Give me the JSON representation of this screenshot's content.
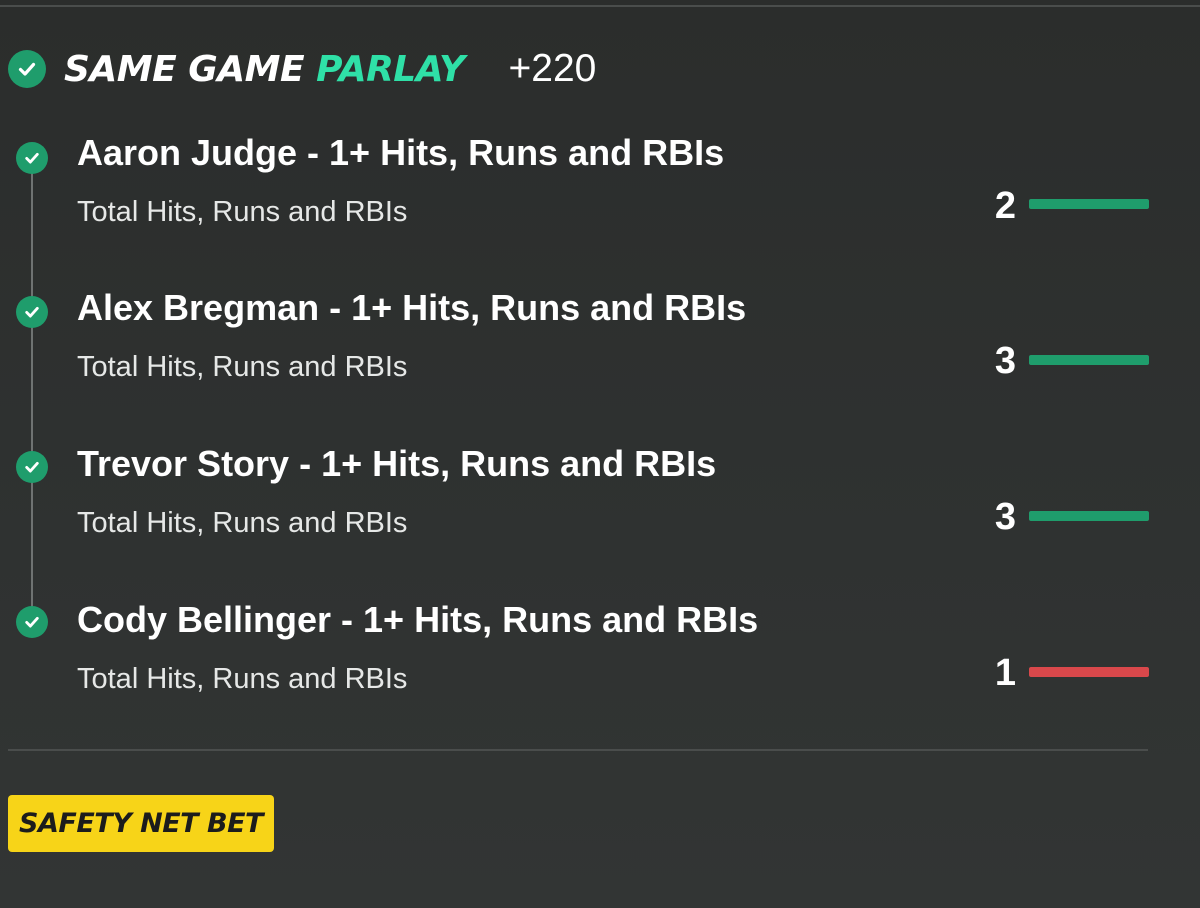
{
  "parlay": {
    "title_main": "SAME GAME",
    "title_accent": "PARLAY",
    "odds": "+220",
    "status_icon": "check-circle-icon"
  },
  "legs": [
    {
      "title": "Aaron Judge - 1+ Hits, Runs and RBIs",
      "subtitle": "Total Hits, Runs and RBIs",
      "value": "2",
      "progress": 1.0,
      "bar_color": "#1f9d6c",
      "status_icon": "check-circle-icon"
    },
    {
      "title": "Alex Bregman - 1+ Hits, Runs and RBIs",
      "subtitle": "Total Hits, Runs and RBIs",
      "value": "3",
      "progress": 1.0,
      "bar_color": "#1f9d6c",
      "status_icon": "check-circle-icon"
    },
    {
      "title": "Trevor Story - 1+ Hits, Runs and RBIs",
      "subtitle": "Total Hits, Runs and RBIs",
      "value": "3",
      "progress": 1.0,
      "bar_color": "#1f9d6c",
      "status_icon": "check-circle-icon"
    },
    {
      "title": "Cody Bellinger - 1+ Hits, Runs and RBIs",
      "subtitle": "Total Hits, Runs and RBIs",
      "value": "1",
      "progress": 1.0,
      "bar_color": "#d9484b",
      "status_icon": "check-circle-icon"
    }
  ],
  "badge": {
    "label": "SAFETY NET BET",
    "color": "#f7d418"
  },
  "colors": {
    "accent": "#2fe0a7",
    "check_green": "#1f9d6c",
    "background": "#2e3130"
  }
}
